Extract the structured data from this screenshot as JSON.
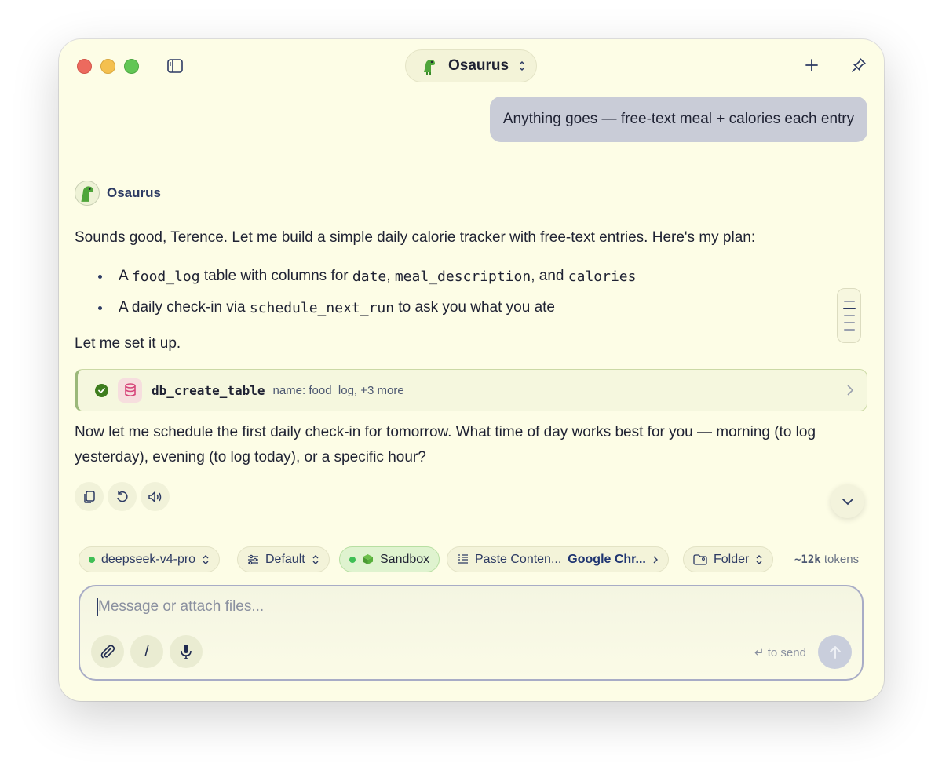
{
  "window": {
    "title": "Osaurus"
  },
  "conversation": {
    "user_message": "Anything goes — free-text meal + calories each entry",
    "assistant_name": "Osaurus",
    "intro": "Sounds good, Terence. Let me build a simple daily calorie tracker with free-text entries. Here's my plan:",
    "bullets": [
      {
        "pre": "A ",
        "code1": "food_log",
        "mid1": " table with columns for ",
        "code2": "date",
        "mid2": ", ",
        "code3": "meal_description",
        "mid3": ", and ",
        "code4": "calories"
      },
      {
        "pre": "A daily check-in via ",
        "code1": "schedule_next_run",
        "post": " to ask you what you ate"
      }
    ],
    "setup_line": "Let me set it up.",
    "tool_call": {
      "name": "db_create_table",
      "args": "name: food_log, +3 more",
      "status": "success"
    },
    "followup": "Now let me schedule the first daily check-in for tomorrow. What time of day works best for you — morning (to log yesterday), evening (to log today), or a specific hour?"
  },
  "toolbar": {
    "model": "deepseek-v4-pro",
    "preset": "Default",
    "sandbox": "Sandbox",
    "paste_label": "Paste Conten...",
    "paste_source": "Google Chr...",
    "folder": "Folder",
    "tokens_count": "~12k",
    "tokens_label": "tokens"
  },
  "composer": {
    "placeholder": "Message or attach files...",
    "slash_label": "/",
    "send_hint": "↵ to send"
  },
  "colors": {
    "window_bg": "#fdfde6",
    "user_bubble": "#c9ccd7",
    "accent_navy": "#2c3a63",
    "success_green": "#3e7d1e",
    "sandbox_green": "#dff3cf"
  },
  "icons": {
    "sidebar": "sidebar-toggle-icon",
    "new_chat": "plus-icon",
    "pin": "pin-icon",
    "copy": "copy-icon",
    "regenerate": "refresh-icon",
    "speak": "speaker-icon",
    "scroll_down": "chevron-down-icon",
    "attach": "paperclip-icon",
    "mic": "microphone-icon",
    "send": "arrow-up-icon"
  }
}
